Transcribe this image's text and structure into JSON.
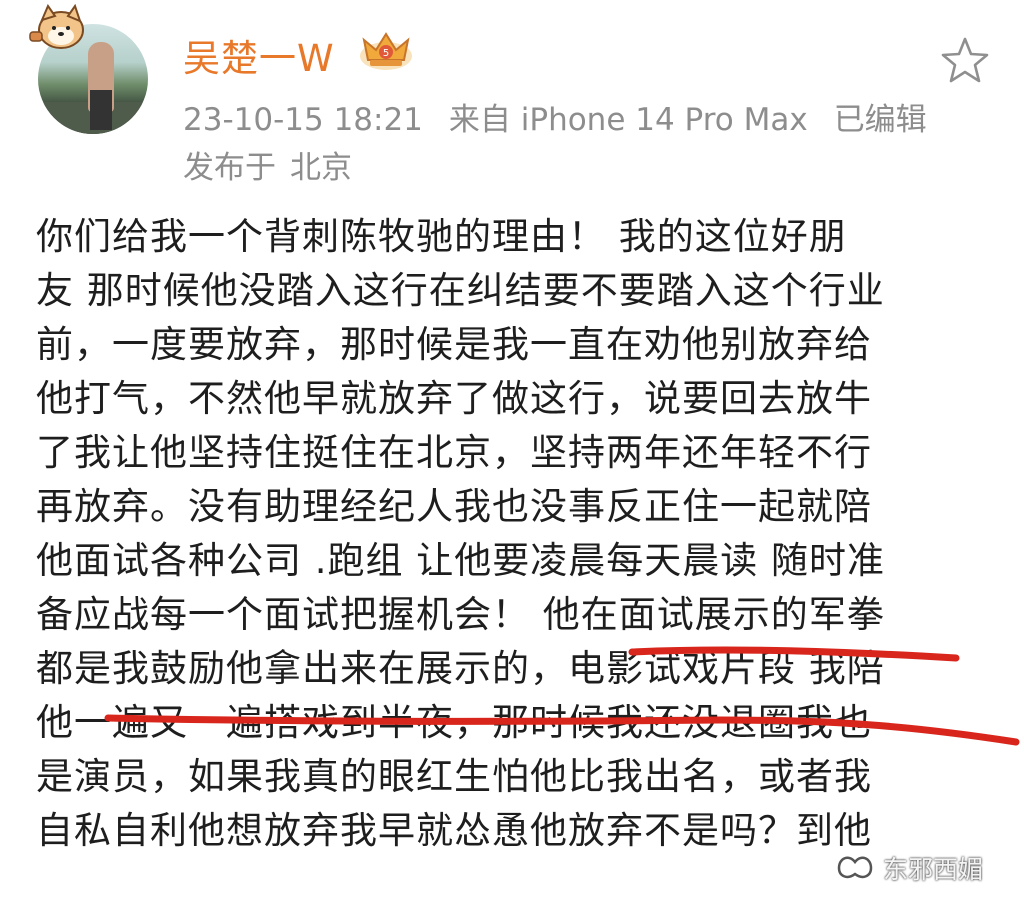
{
  "post": {
    "username": "吴楚一W",
    "timestamp": "23-10-15 18:21",
    "source": "来自 iPhone 14 Pro Max",
    "edited": "已编辑",
    "location_prefix": "发布于",
    "location": "北京",
    "lines": [
      "你们给我一个背刺陈牧驰的理由！ 我的这位好朋",
      "友 那时候他没踏入这行在纠结要不要踏入这个行业",
      "前，一度要放弃，那时候是我一直在劝他别放弃给",
      "他打气，不然他早就放弃了做这行，说要回去放牛",
      "了我让他坚持住挺住在北京，坚持两年还年轻不行",
      "再放弃。没有助理经纪人我也没事反正住一起就陪",
      "他面试各种公司 .跑组 让他要凌晨每天晨读 随时准",
      "备应战每一个面试把握机会！ 他在面试展示的军拳",
      "都是我鼓励他拿出来在展示的，电影试戏片段 我陪",
      "他一遍又一遍搭戏到半夜，那时候我还没退圈我也",
      "是演员，如果我真的眼红生怕他比我出名，或者我",
      "自私自利他想放弃我早就怂恿他放弃不是吗？到他"
    ]
  },
  "watermark": {
    "text": "东邪西媚"
  },
  "icons": {
    "favorite": "star-outline-icon",
    "badge": "crown-badge-icon",
    "avatar_badge": "shiba-dog-icon",
    "watermark_icon": "wechat-channel-icon"
  },
  "colors": {
    "username": "#e8782a",
    "meta": "#8d8d8d",
    "body": "#1e1e1e",
    "underline": "#d9261c"
  }
}
